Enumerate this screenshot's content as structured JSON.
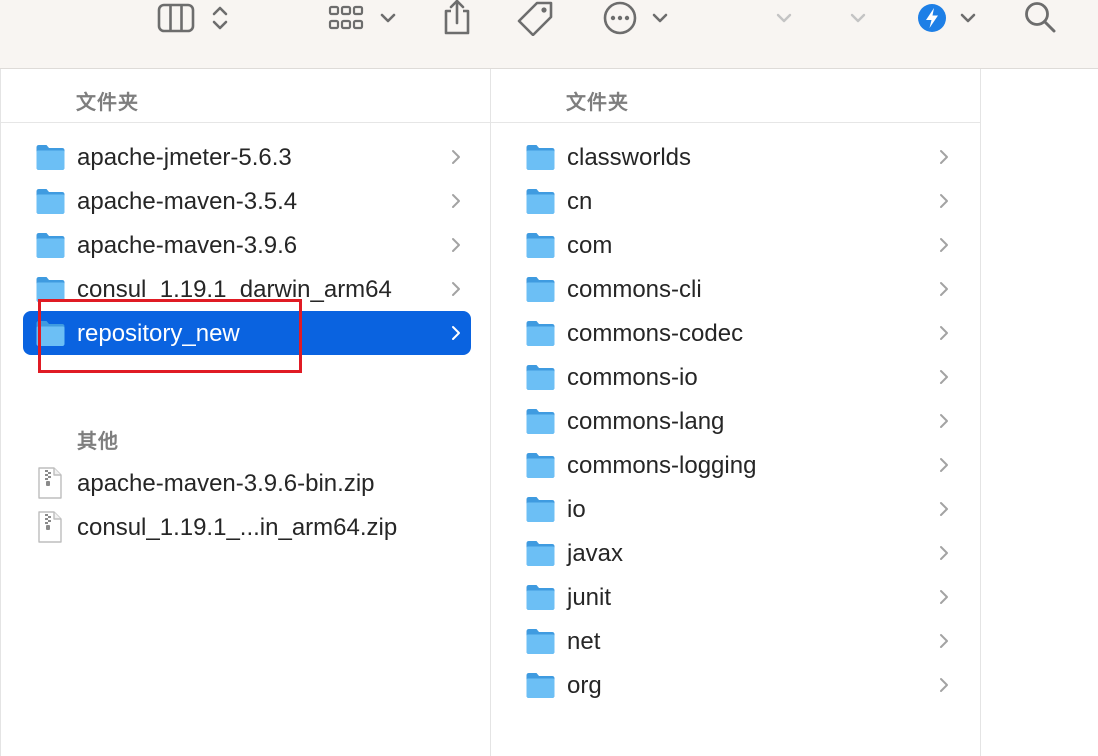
{
  "toolbar": {
    "icons": [
      "column-view-icon",
      "updown-chevron-icon",
      "grid-view-icon",
      "chevron-down-icon",
      "share-icon",
      "tag-icon",
      "more-icon",
      "chevron-down-icon",
      "chevron-down-icon",
      "chevron-down-icon",
      "action-icon",
      "chevron-down-icon",
      "search-icon"
    ]
  },
  "column1": {
    "header": "文件夹",
    "folders": [
      {
        "name": "apache-jmeter-5.6.3"
      },
      {
        "name": "apache-maven-3.5.4"
      },
      {
        "name": "apache-maven-3.9.6"
      },
      {
        "name": "consul_1.19.1_darwin_arm64"
      },
      {
        "name": "repository_new",
        "selected": true
      }
    ],
    "other_header": "其他",
    "files": [
      {
        "name": "apache-maven-3.9.6-bin.zip"
      },
      {
        "name": "consul_1.19.1_...in_arm64.zip"
      }
    ]
  },
  "column2": {
    "header": "文件夹",
    "folders": [
      {
        "name": "classworlds"
      },
      {
        "name": "cn"
      },
      {
        "name": "com"
      },
      {
        "name": "commons-cli"
      },
      {
        "name": "commons-codec"
      },
      {
        "name": "commons-io"
      },
      {
        "name": "commons-lang"
      },
      {
        "name": "commons-logging"
      },
      {
        "name": "io"
      },
      {
        "name": "javax"
      },
      {
        "name": "junit"
      },
      {
        "name": "net"
      },
      {
        "name": "org"
      }
    ]
  },
  "colors": {
    "selection": "#0a63e0",
    "annotation": "#e01b24",
    "folder": "#5ab4f0",
    "accent": "#1e7fe6"
  }
}
